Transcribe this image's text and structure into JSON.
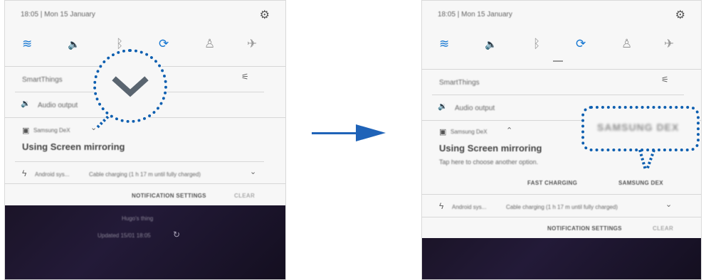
{
  "left": {
    "status_text": "18:05 | Mon 15 January",
    "smartthings_label": "SmartThings",
    "audio_output_label": "Audio output",
    "app_name": "Samsung DeX",
    "notification_title": "Using Screen mirroring",
    "charging_app": "Android sys...",
    "charging_text": "Cable charging (1 h 17 m until fully charged)",
    "notification_settings": "NOTIFICATION SETTINGS",
    "clear": "CLEAR",
    "lock_line1": "Hugo's thing",
    "lock_line2": "Updated 15/01 18:05"
  },
  "right": {
    "status_text": "18:05 | Mon 15 January",
    "smartthings_label": "SmartThings",
    "audio_output_label": "Audio output",
    "app_name": "Samsung DeX",
    "notification_title": "Using Screen mirroring",
    "notification_subtitle": "Tap here to choose another option.",
    "fast_charging_button": "FAST CHARGING",
    "samsung_dex_button": "SAMSUNG DEX",
    "callout_text": "SAMSUNG DEX",
    "charging_app": "Android sys...",
    "charging_text": "Cable charging (1 h 17 m until fully charged)",
    "notification_settings": "NOTIFICATION SETTINGS",
    "clear": "CLEAR"
  },
  "icons": {
    "gear": "⚙",
    "wifi": "≋",
    "sound": "🔈",
    "bluetooth": "ᛒ",
    "rotate": "⟳",
    "flashlight": "♙",
    "airplane": "✈",
    "tune": "⚟",
    "speaker": "🔉",
    "app": "▣",
    "chevron_down": "⌄",
    "chevron_up": "⌃",
    "bolt": "ϟ",
    "refresh": "↻"
  },
  "colors": {
    "accent": "#1677d2",
    "callout": "#0d5fb0",
    "arrow": "#1f63b8"
  }
}
